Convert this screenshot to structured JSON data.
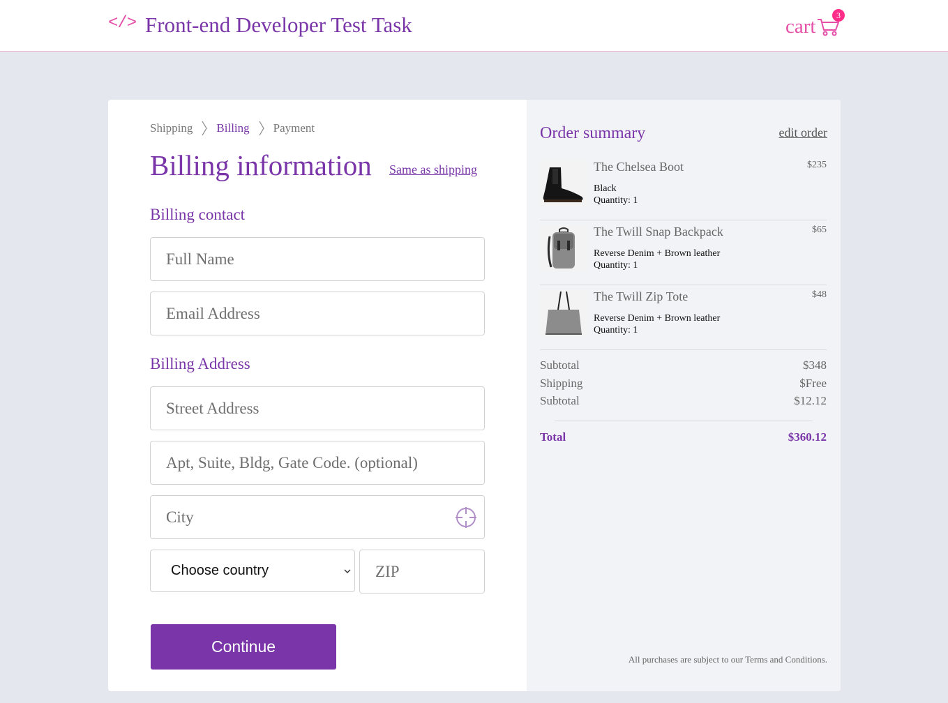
{
  "header": {
    "logo_icon": "</>",
    "title": "Front-end Developer Test Task",
    "cart_label": "cart",
    "cart_count": "3"
  },
  "breadcrumb": {
    "items": [
      "Shipping",
      "Billing",
      "Payment"
    ],
    "active": "Billing"
  },
  "billing": {
    "title": "Billing information",
    "same_as_shipping": "Same as shipping",
    "contact_label": "Billing contact",
    "address_label": "Billing Address",
    "fields": {
      "full_name": "Full Name",
      "email": "Email Address",
      "street": "Street Address",
      "apt": "Apt, Suite, Bldg, Gate Code. (optional)",
      "city": "City",
      "zip": "ZIP"
    },
    "country_select": "Choose country",
    "continue_label": "Continue"
  },
  "summary": {
    "title": "Order summary",
    "edit_label": "edit order",
    "items": [
      {
        "name": "The Chelsea Boot",
        "price": "$235",
        "variant": "Black",
        "quantity": "Quantity: 1",
        "icon": "boot-image"
      },
      {
        "name": "The Twill Snap Backpack",
        "price": "$65",
        "variant": "Reverse Denim + Brown leather",
        "quantity": "Quantity: 1",
        "icon": "backpack-image"
      },
      {
        "name": "The Twill Zip Tote",
        "price": "$48",
        "variant": "Reverse Denim + Brown leather",
        "quantity": "Quantity: 1",
        "icon": "tote-image"
      }
    ],
    "subtotal_label": "Subtotal",
    "subtotal_value": "$348",
    "shipping_label": "Shipping",
    "shipping_value": "$Free",
    "tax_label": "Subtotal",
    "tax_value": "$12.12",
    "total_label": "Total",
    "total_value": "$360.12",
    "terms": "All purchases are subject to our Terms and Conditions."
  },
  "colors": {
    "brand_purple": "#7a36a8",
    "accent_pink": "#e64fa8",
    "background": "#e4e7ee"
  }
}
